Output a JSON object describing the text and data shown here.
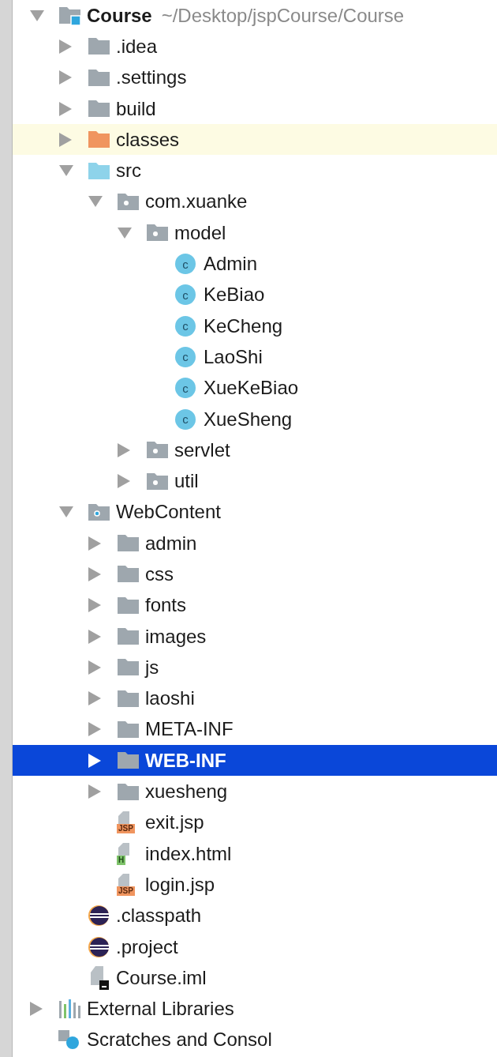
{
  "tree": [
    {
      "label": "Course",
      "hint": "~/Desktop/jspCourse/Course",
      "kind": "module",
      "expanded": true,
      "selected": false,
      "children": [
        {
          "label": ".idea",
          "kind": "folder",
          "expanded": false,
          "selected": false
        },
        {
          "label": ".settings",
          "kind": "folder",
          "expanded": false,
          "selected": false
        },
        {
          "label": "build",
          "kind": "folder",
          "expanded": false,
          "selected": false
        },
        {
          "label": "classes",
          "kind": "excluded-folder",
          "expanded": false,
          "selected": false,
          "highlighted": true
        },
        {
          "label": "src",
          "kind": "source-folder",
          "expanded": true,
          "selected": false,
          "children": [
            {
              "label": "com.xuanke",
              "kind": "package",
              "expanded": true,
              "selected": false,
              "children": [
                {
                  "label": "model",
                  "kind": "package",
                  "expanded": true,
                  "selected": false,
                  "children": [
                    {
                      "label": "Admin",
                      "kind": "class",
                      "badge": "c",
                      "selected": false
                    },
                    {
                      "label": "KeBiao",
                      "kind": "class",
                      "badge": "c",
                      "selected": false
                    },
                    {
                      "label": "KeCheng",
                      "kind": "class",
                      "badge": "c",
                      "selected": false
                    },
                    {
                      "label": "LaoShi",
                      "kind": "class",
                      "badge": "c",
                      "selected": false
                    },
                    {
                      "label": "XueKeBiao",
                      "kind": "class",
                      "badge": "c",
                      "selected": false
                    },
                    {
                      "label": "XueSheng",
                      "kind": "class",
                      "badge": "c",
                      "selected": false
                    }
                  ]
                },
                {
                  "label": "servlet",
                  "kind": "package",
                  "expanded": false,
                  "selected": false
                },
                {
                  "label": "util",
                  "kind": "package",
                  "expanded": false,
                  "selected": false
                }
              ]
            }
          ]
        },
        {
          "label": "WebContent",
          "kind": "web-folder",
          "expanded": true,
          "selected": false,
          "children": [
            {
              "label": "admin",
              "kind": "folder",
              "expanded": false,
              "selected": false
            },
            {
              "label": "css",
              "kind": "folder",
              "expanded": false,
              "selected": false
            },
            {
              "label": "fonts",
              "kind": "folder",
              "expanded": false,
              "selected": false
            },
            {
              "label": "images",
              "kind": "folder",
              "expanded": false,
              "selected": false
            },
            {
              "label": "js",
              "kind": "folder",
              "expanded": false,
              "selected": false
            },
            {
              "label": "laoshi",
              "kind": "folder",
              "expanded": false,
              "selected": false
            },
            {
              "label": "META-INF",
              "kind": "folder",
              "expanded": false,
              "selected": false
            },
            {
              "label": "WEB-INF",
              "kind": "folder",
              "expanded": false,
              "selected": true
            },
            {
              "label": "xuesheng",
              "kind": "folder",
              "expanded": false,
              "selected": false
            },
            {
              "label": "exit.jsp",
              "kind": "jsp",
              "badge": "JSP",
              "selected": false
            },
            {
              "label": "index.html",
              "kind": "html",
              "badge": "H",
              "selected": false
            },
            {
              "label": "login.jsp",
              "kind": "jsp",
              "badge": "JSP",
              "selected": false
            }
          ]
        },
        {
          "label": ".classpath",
          "kind": "eclipse",
          "selected": false
        },
        {
          "label": ".project",
          "kind": "eclipse",
          "selected": false
        },
        {
          "label": "Course.iml",
          "kind": "iml",
          "selected": false
        }
      ]
    },
    {
      "label": "External Libraries",
      "kind": "libraries",
      "expanded": false,
      "selected": false
    },
    {
      "label": "Scratches and Consol",
      "kind": "scratches",
      "selected": false
    }
  ]
}
